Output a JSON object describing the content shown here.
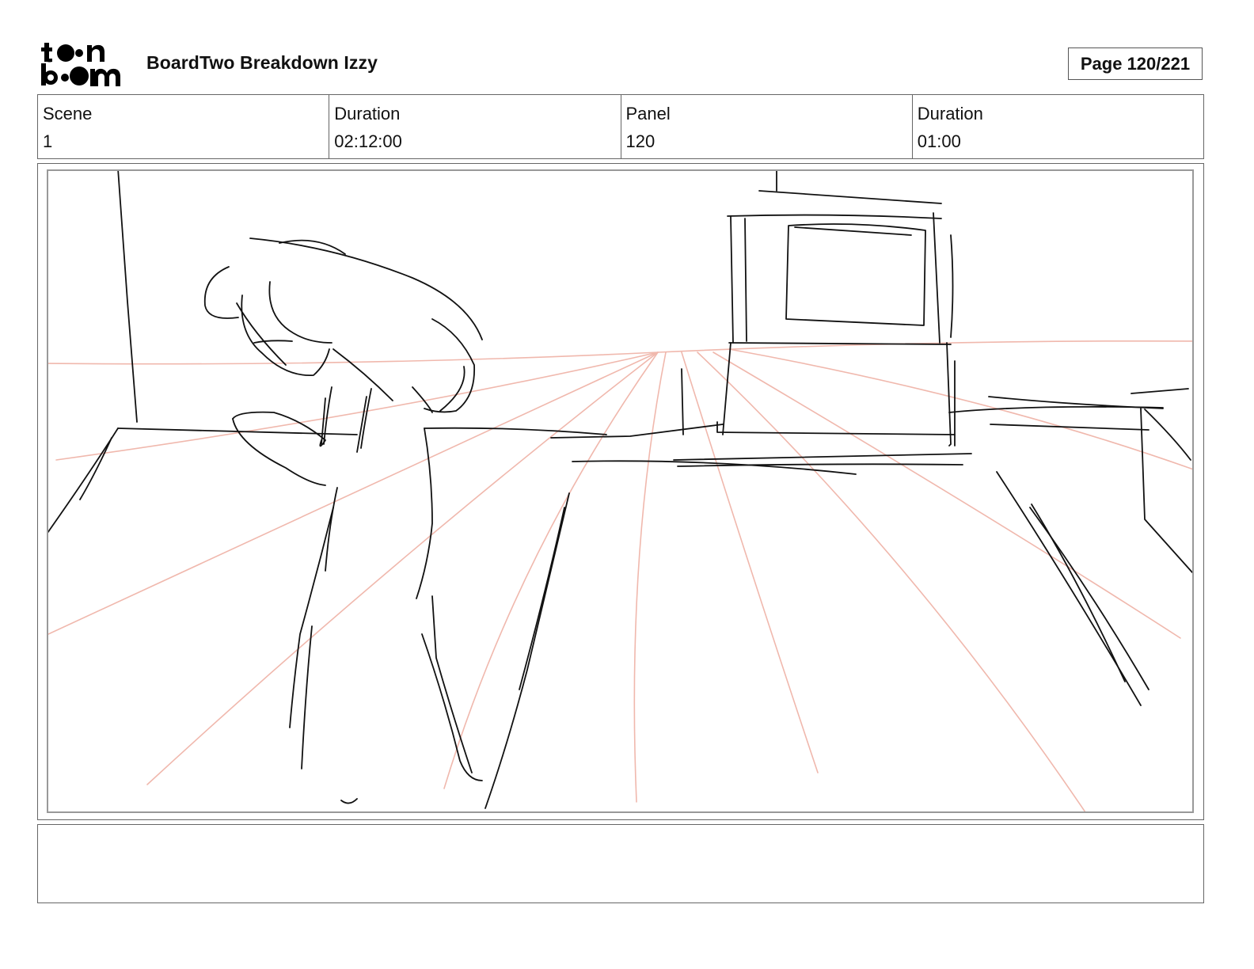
{
  "header": {
    "logo_text": "toon boom",
    "title": "BoardTwo Breakdown Izzy",
    "page_indicator": "Page 120/221"
  },
  "info": {
    "scene": {
      "label": "Scene",
      "value": "1"
    },
    "scene_duration": {
      "label": "Duration",
      "value": "02:12:00"
    },
    "panel": {
      "label": "Panel",
      "value": "120"
    },
    "panel_duration": {
      "label": "Duration",
      "value": "01:00"
    }
  },
  "panel_image": {
    "icon": "rough-sketch",
    "ink_color": "#111111",
    "guide_color": "#f0b8ad"
  },
  "notes": {
    "text": ""
  }
}
